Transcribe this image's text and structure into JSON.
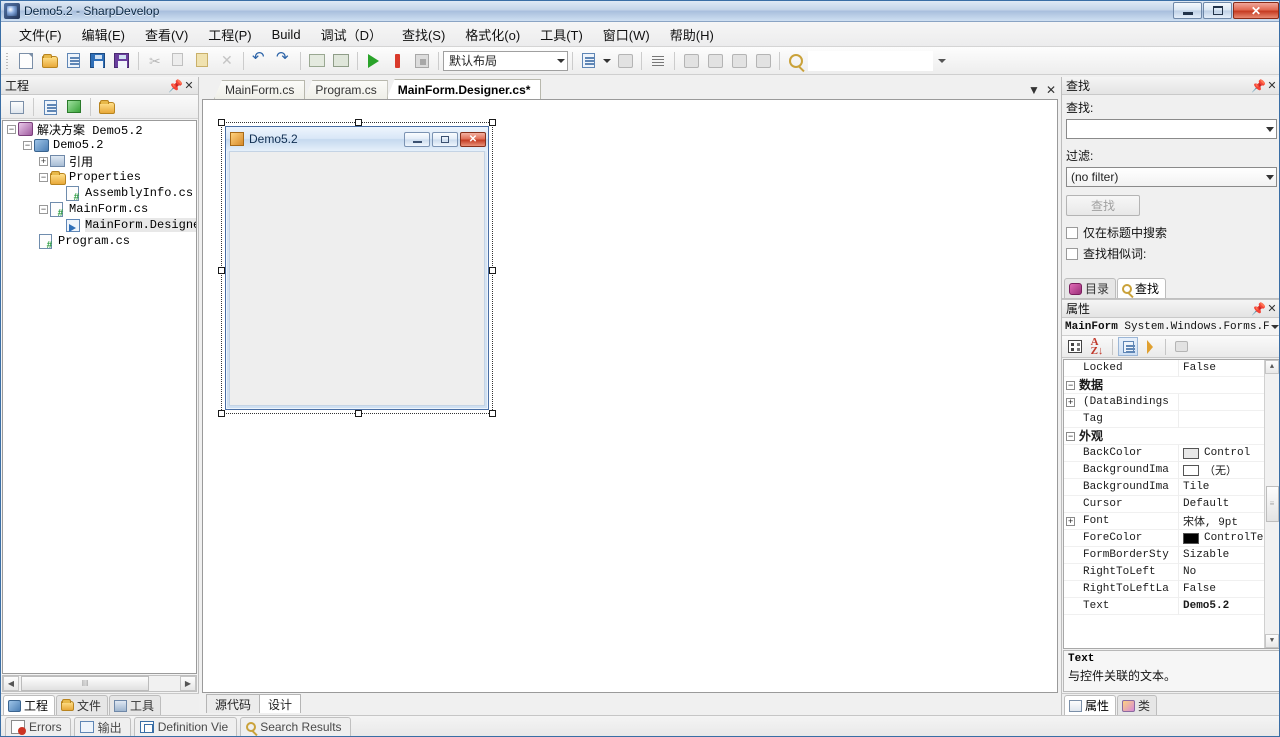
{
  "window": {
    "title": "Demo5.2 - SharpDevelop",
    "icon": "sharpdevelop-icon",
    "buttons": {
      "minimize": "minimize-button",
      "maximize": "maximize-button",
      "close": "close-button",
      "close_glyph": "✕"
    }
  },
  "menubar": {
    "items": [
      {
        "label": "文件(F)",
        "name": "menu-file"
      },
      {
        "label": "编辑(E)",
        "name": "menu-edit"
      },
      {
        "label": "查看(V)",
        "name": "menu-view"
      },
      {
        "label": "工程(P)",
        "name": "menu-project"
      },
      {
        "label": "Build",
        "name": "menu-build"
      },
      {
        "label": "调试（D）",
        "name": "menu-debug"
      },
      {
        "label": "查找(S)",
        "name": "menu-search"
      },
      {
        "label": "格式化(o)",
        "name": "menu-format"
      },
      {
        "label": "工具(T)",
        "name": "menu-tools"
      },
      {
        "label": "窗口(W)",
        "name": "menu-window"
      },
      {
        "label": "帮助(H)",
        "name": "menu-help"
      }
    ]
  },
  "toolbar": {
    "layout_combo_value": "默认布局",
    "icons": [
      "new-file-icon",
      "open-file-icon",
      "new-project-icon",
      "save-icon",
      "save-all-icon",
      "cut-icon",
      "copy-icon",
      "paste-icon",
      "delete-icon",
      "undo-icon",
      "redo-icon",
      "comment-icon",
      "uncomment-icon",
      "run-icon",
      "error-icon",
      "stop-icon"
    ],
    "right_icons": [
      "bookmark-icon",
      "bookmark-next-icon",
      "format-icon",
      "panel1-icon",
      "panel2-icon",
      "panel3-icon",
      "panel4-icon",
      "find-icon"
    ],
    "search_combo_value": ""
  },
  "project_panel": {
    "title": "工程",
    "pin_glyph": "中",
    "close_glyph": "✕",
    "toolbar_icons": [
      "properties-icon",
      "show-all-files-icon",
      "refresh-icon",
      "open-folder-icon"
    ],
    "tree": [
      {
        "indent": 0,
        "expander": "-",
        "icon": "solution-icon",
        "label": "解决方案 Demo5.2",
        "name": "tree-node-solution"
      },
      {
        "indent": 1,
        "expander": "-",
        "icon": "project-icon",
        "label": "Demo5.2",
        "name": "tree-node-project"
      },
      {
        "indent": 2,
        "expander": "+",
        "icon": "references-icon",
        "label": "引用",
        "name": "tree-node-references"
      },
      {
        "indent": 2,
        "expander": "-",
        "icon": "folder-icon",
        "label": "Properties",
        "name": "tree-node-properties"
      },
      {
        "indent": 3,
        "expander": "",
        "icon": "cs-file-icon",
        "label": "AssemblyInfo.cs",
        "name": "tree-node-assemblyinfo"
      },
      {
        "indent": 2,
        "expander": "-",
        "icon": "cs-file-icon",
        "label": "MainForm.cs",
        "name": "tree-node-mainform"
      },
      {
        "indent": 3,
        "expander": "",
        "icon": "designer-file-icon",
        "label": "MainForm.Designe",
        "name": "tree-node-mainform-designer",
        "selected": true
      },
      {
        "indent": 2,
        "expander": "",
        "icon": "cs-file-icon",
        "label": "Program.cs",
        "name": "tree-node-program"
      }
    ],
    "scrollbar": {
      "left_glyph": "◀",
      "right_glyph": "▶",
      "thumb_glyph": "‖‖"
    },
    "bottom_tabs": [
      {
        "label": "工程",
        "icon": "project-tab-icon",
        "active": true,
        "name": "tab-project"
      },
      {
        "label": "文件",
        "icon": "files-tab-icon",
        "active": false,
        "name": "tab-files"
      },
      {
        "label": "工具",
        "icon": "tools-tab-icon",
        "active": false,
        "name": "tab-tools"
      }
    ]
  },
  "document_area": {
    "tabs": [
      {
        "label": "MainForm.cs",
        "active": false,
        "name": "doctab-mainform-cs"
      },
      {
        "label": "Program.cs",
        "active": false,
        "name": "doctab-program-cs"
      },
      {
        "label": "MainForm.Designer.cs*",
        "active": true,
        "name": "doctab-mainform-designer-cs"
      }
    ],
    "tab_menu_glyph": "▼",
    "tab_close_glyph": "✕",
    "designer_form": {
      "title": "Demo5.2",
      "icon": "form-icon",
      "minimize_glyph": "─",
      "maximize_glyph": "□",
      "close_glyph": "✕"
    },
    "view_tabs": [
      {
        "label": "源代码",
        "active": false,
        "name": "viewtab-source"
      },
      {
        "label": "设计",
        "active": true,
        "name": "viewtab-design"
      }
    ]
  },
  "find_panel": {
    "title": "查找",
    "pin_glyph": "中",
    "close_glyph": "✕",
    "search_label": "查找:",
    "search_value": "",
    "filter_label": "过滤:",
    "filter_value": "(no filter)",
    "find_button": "查找",
    "checkbox_title_only": "仅在标题中搜索",
    "checkbox_similar": "查找相似词:",
    "tabs": [
      {
        "label": "目录",
        "icon": "contents-icon",
        "active": false,
        "name": "tab-contents"
      },
      {
        "label": "查找",
        "icon": "search-tab-icon",
        "active": true,
        "name": "tab-search"
      }
    ]
  },
  "properties_panel": {
    "title": "属性",
    "pin_glyph": "中",
    "close_glyph": "✕",
    "object_name": "MainForm",
    "object_type": "System.Windows.Forms.F",
    "toolbar_buttons": [
      {
        "name": "categorized-button",
        "icon": "category-icon",
        "active": false
      },
      {
        "name": "alphabetical-button",
        "icon": "sort-az-icon",
        "active": false
      },
      {
        "name": "properties-button",
        "icon": "property-pages-icon",
        "active": true
      },
      {
        "name": "events-button",
        "icon": "events-bolt-icon",
        "active": false
      },
      {
        "name": "property-pages-button",
        "icon": "page-icon",
        "active": false
      }
    ],
    "rows": [
      {
        "type": "prop",
        "name": "Locked",
        "value": "False",
        "name_attr": "prop-locked"
      },
      {
        "type": "category",
        "name": "数据",
        "expander": "-",
        "name_attr": "prop-category-data"
      },
      {
        "type": "prop",
        "name": "(DataBindings",
        "value": "",
        "expander": "+",
        "name_attr": "prop-databindings"
      },
      {
        "type": "prop",
        "name": "Tag",
        "value": "",
        "name_attr": "prop-tag"
      },
      {
        "type": "category",
        "name": "外观",
        "expander": "-",
        "name_attr": "prop-category-appearance"
      },
      {
        "type": "prop",
        "name": "BackColor",
        "value": "Control",
        "swatch": "#e8e8e8",
        "name_attr": "prop-backcolor"
      },
      {
        "type": "prop",
        "name": "BackgroundIma",
        "value": "（无）",
        "swatch": "#ffffff",
        "name_attr": "prop-backgroundimage"
      },
      {
        "type": "prop",
        "name": "BackgroundIma",
        "value": "Tile",
        "name_attr": "prop-backgroundimagelayout"
      },
      {
        "type": "prop",
        "name": "Cursor",
        "value": "Default",
        "name_attr": "prop-cursor"
      },
      {
        "type": "prop",
        "name": "Font",
        "value": "宋体, 9pt",
        "expander": "+",
        "name_attr": "prop-font"
      },
      {
        "type": "prop",
        "name": "ForeColor",
        "value": "ControlText",
        "swatch": "#000000",
        "name_attr": "prop-forecolor"
      },
      {
        "type": "prop",
        "name": "FormBorderSty",
        "value": "Sizable",
        "name_attr": "prop-formborderstyle"
      },
      {
        "type": "prop",
        "name": "RightToLeft",
        "value": "No",
        "name_attr": "prop-righttoleft"
      },
      {
        "type": "prop",
        "name": "RightToLeftLa",
        "value": "False",
        "name_attr": "prop-righttoleftlayout"
      },
      {
        "type": "prop",
        "name": "Text",
        "value": "Demo5.2",
        "bold": true,
        "name_attr": "prop-text"
      }
    ],
    "description": {
      "title": "Text",
      "body": "与控件关联的文本。"
    },
    "bottom_tabs": [
      {
        "label": "属性",
        "icon": "properties-tab-icon",
        "active": true,
        "name": "tab-properties"
      },
      {
        "label": "类",
        "icon": "classes-tab-icon",
        "active": false,
        "name": "tab-classes"
      }
    ]
  },
  "bottom_bar": {
    "tabs": [
      {
        "label": "Errors",
        "icon": "errors-icon",
        "name": "bottomtab-errors"
      },
      {
        "label": "输出",
        "icon": "output-icon",
        "name": "bottomtab-output"
      },
      {
        "label": "Definition Vie",
        "icon": "definition-view-icon",
        "name": "bottomtab-definition-view"
      },
      {
        "label": "Search Results",
        "icon": "search-results-icon",
        "name": "bottomtab-search-results"
      }
    ]
  }
}
